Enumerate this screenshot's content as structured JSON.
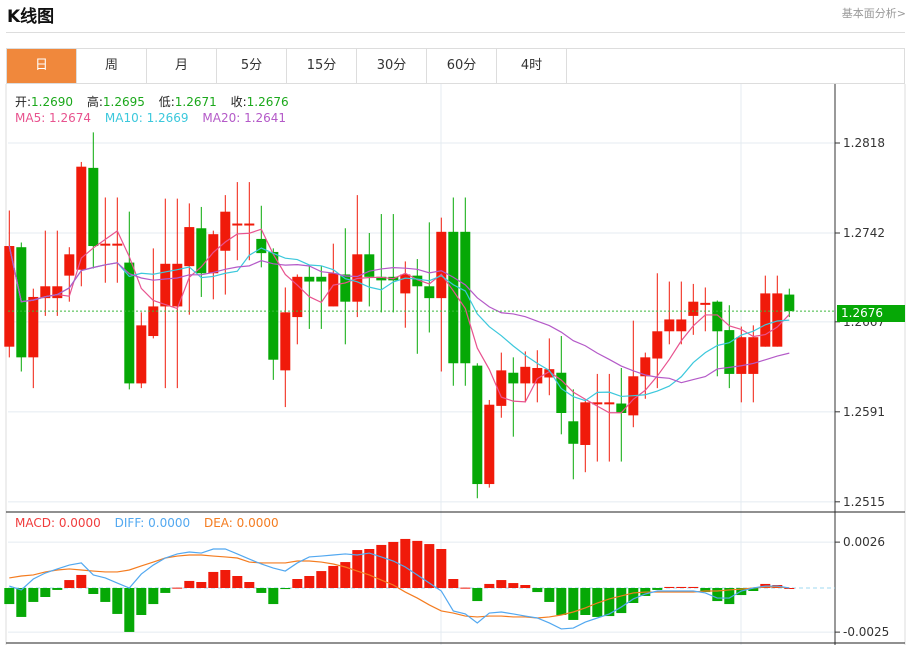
{
  "header": {
    "title": "K线图",
    "link": "基本面分析>"
  },
  "tabs": [
    {
      "label": "日",
      "active": true
    },
    {
      "label": "周"
    },
    {
      "label": "月"
    },
    {
      "label": "5分"
    },
    {
      "label": "15分"
    },
    {
      "label": "30分"
    },
    {
      "label": "60分"
    },
    {
      "label": "4时"
    }
  ],
  "ohlc_legend": {
    "open_label": "开:",
    "open": "1.2690",
    "high_label": "高:",
    "high": "1.2695",
    "low_label": "低:",
    "low": "1.2671",
    "close_label": "收:",
    "close": "1.2676"
  },
  "ma_legend": {
    "ma5": "MA5: 1.2674",
    "ma10": "MA10: 1.2669",
    "ma20": "MA20: 1.2641"
  },
  "macd_legend": {
    "macd": "MACD: 0.0000",
    "diff": "DIFF: 0.0000",
    "dea": "DEA: 0.0000"
  },
  "current_price": "1.2676",
  "colors": {
    "up": "#f01a0a",
    "down": "#06a806",
    "ma5": "#e8538f",
    "ma10": "#3cc8dc",
    "ma20": "#b45ac8",
    "diff": "#52a8f0",
    "dea": "#f47c20",
    "active_tab": "#f0883c"
  },
  "chart_data": [
    {
      "type": "candlestick",
      "ylim": [
        1.2505,
        1.283
      ],
      "yticks": [
        "1.2818",
        "1.2742",
        "1.2667",
        "1.2591",
        "1.2515"
      ],
      "grid": true,
      "ohlc": [
        [
          1.2646,
          1.2761,
          1.2637,
          1.2731
        ],
        [
          1.273,
          1.2734,
          1.2625,
          1.2637
        ],
        [
          1.2637,
          1.2695,
          1.2611,
          1.2688
        ],
        [
          1.2687,
          1.2744,
          1.2672,
          1.2697
        ],
        [
          1.2687,
          1.2744,
          1.2672,
          1.2697
        ],
        [
          1.2706,
          1.273,
          1.2684,
          1.2724
        ],
        [
          1.2711,
          1.2802,
          1.2697,
          1.2798
        ],
        [
          1.2797,
          1.2827,
          1.2712,
          1.2731
        ],
        [
          1.2733,
          1.2772,
          1.27,
          1.2733
        ],
        [
          1.2733,
          1.2772,
          1.27,
          1.2733
        ],
        [
          1.2717,
          1.276,
          1.261,
          1.2615
        ],
        [
          1.2615,
          1.2675,
          1.2611,
          1.2664
        ],
        [
          1.2655,
          1.2729,
          1.2653,
          1.268
        ],
        [
          1.268,
          1.2771,
          1.2611,
          1.2716
        ],
        [
          1.268,
          1.2771,
          1.2611,
          1.2716
        ],
        [
          1.2714,
          1.2767,
          1.2673,
          1.2747
        ],
        [
          1.2746,
          1.2764,
          1.2688,
          1.2708
        ],
        [
          1.2708,
          1.2744,
          1.2686,
          1.2741
        ],
        [
          1.2727,
          1.2774,
          1.269,
          1.276
        ],
        [
          1.275,
          1.2785,
          1.2719,
          1.275
        ],
        [
          1.275,
          1.2785,
          1.2719,
          1.275
        ],
        [
          1.2737,
          1.2765,
          1.2713,
          1.2725
        ],
        [
          1.2726,
          1.2729,
          1.2618,
          1.2635
        ],
        [
          1.2626,
          1.2696,
          1.2595,
          1.2675
        ],
        [
          1.2671,
          1.2707,
          1.2648,
          1.2705
        ],
        [
          1.2705,
          1.2714,
          1.2661,
          1.2701
        ],
        [
          1.2705,
          1.2714,
          1.2661,
          1.2701
        ],
        [
          1.268,
          1.2733,
          1.268,
          1.2708
        ],
        [
          1.2707,
          1.2746,
          1.2648,
          1.2684
        ],
        [
          1.2684,
          1.2774,
          1.2671,
          1.2724
        ],
        [
          1.2724,
          1.2742,
          1.268,
          1.2705
        ],
        [
          1.2705,
          1.2758,
          1.2675,
          1.2702
        ],
        [
          1.2705,
          1.2758,
          1.2675,
          1.2702
        ],
        [
          1.2691,
          1.2718,
          1.2662,
          1.2707
        ],
        [
          1.2706,
          1.272,
          1.264,
          1.2697
        ],
        [
          1.2697,
          1.2751,
          1.2658,
          1.2687
        ],
        [
          1.2687,
          1.2755,
          1.2625,
          1.2743
        ],
        [
          1.2743,
          1.2772,
          1.2613,
          1.2632
        ],
        [
          1.2743,
          1.2772,
          1.2613,
          1.2632
        ],
        [
          1.263,
          1.2632,
          1.2518,
          1.253
        ],
        [
          1.253,
          1.2601,
          1.2527,
          1.2597
        ],
        [
          1.2596,
          1.2641,
          1.2586,
          1.2626
        ],
        [
          1.2624,
          1.2637,
          1.257,
          1.2615
        ],
        [
          1.2615,
          1.2642,
          1.2599,
          1.2629
        ],
        [
          1.2615,
          1.2643,
          1.2599,
          1.2628
        ],
        [
          1.262,
          1.2653,
          1.2605,
          1.2627
        ],
        [
          1.2624,
          1.2655,
          1.2572,
          1.259
        ],
        [
          1.2583,
          1.261,
          1.2534,
          1.2564
        ],
        [
          1.2563,
          1.2601,
          1.254,
          1.2599
        ],
        [
          1.2599,
          1.2623,
          1.2549,
          1.2599
        ],
        [
          1.2599,
          1.2623,
          1.2549,
          1.2599
        ],
        [
          1.2598,
          1.2628,
          1.2549,
          1.259
        ],
        [
          1.2588,
          1.2668,
          1.2578,
          1.2621
        ],
        [
          1.2621,
          1.2641,
          1.2602,
          1.2637
        ],
        [
          1.2636,
          1.2708,
          1.2611,
          1.2659
        ],
        [
          1.2659,
          1.2701,
          1.2648,
          1.2669
        ],
        [
          1.2659,
          1.2701,
          1.2648,
          1.2669
        ],
        [
          1.2672,
          1.2699,
          1.2656,
          1.2684
        ],
        [
          1.2683,
          1.2696,
          1.2659,
          1.2683
        ],
        [
          1.2684,
          1.2685,
          1.2621,
          1.2659
        ],
        [
          1.266,
          1.2681,
          1.2611,
          1.2623
        ],
        [
          1.2623,
          1.2663,
          1.2599,
          1.2654
        ],
        [
          1.2623,
          1.2664,
          1.2599,
          1.2654
        ],
        [
          1.2646,
          1.2706,
          1.2646,
          1.2691
        ],
        [
          1.2646,
          1.2706,
          1.2646,
          1.2691
        ],
        [
          1.269,
          1.2695,
          1.2671,
          1.2676
        ]
      ]
    },
    {
      "type": "bar+line",
      "ylim": [
        -0.0028,
        0.0036
      ],
      "yticks": [
        "0.0026",
        "-0.0025"
      ],
      "macd": [
        -0.00091,
        -0.00164,
        -0.00079,
        -0.00051,
        -0.00011,
        0.00045,
        0.00074,
        -0.00034,
        -0.00079,
        -0.00147,
        -0.00249,
        -0.00153,
        -0.00091,
        -0.00028,
        2e-05,
        0.0004,
        0.00034,
        0.00091,
        0.00102,
        0.00068,
        0.00034,
        -0.00028,
        -0.00091,
        -6e-05,
        0.00051,
        0.00068,
        0.00096,
        0.00125,
        0.00147,
        0.00215,
        0.00221,
        0.00244,
        0.00261,
        0.00278,
        0.00267,
        0.00249,
        0.00221,
        0.00051,
        2e-05,
        -0.00074,
        0.00023,
        0.00045,
        0.00028,
        0.00017,
        -0.00023,
        -0.00079,
        -0.00153,
        -0.00181,
        -0.00153,
        -0.00164,
        -0.00159,
        -0.00142,
        -0.00085,
        -0.00045,
        -0.00011,
        6e-05,
        6e-05,
        6e-05,
        -0.00023,
        -0.00074,
        -0.00091,
        -0.0004,
        -0.00017,
        0.00023,
        0.00017,
        0
      ],
      "diff": [
        0.00011,
        -0.00011,
        0.00051,
        0.00085,
        0.00108,
        0.0013,
        0.00142,
        0.00074,
        0.00057,
        0.00028,
        0,
        0.00079,
        0.0013,
        0.0017,
        0.00193,
        0.00204,
        0.00198,
        0.00221,
        0.00221,
        0.00193,
        0.00164,
        0.00136,
        0.00113,
        0.00096,
        0.00142,
        0.00176,
        0.00181,
        0.00187,
        0.00193,
        0.00187,
        0.00198,
        0.00176,
        0.00153,
        0.00119,
        0.00074,
        0.00028,
        -0.00017,
        -0.0013,
        -0.00147,
        -0.00198,
        -0.00142,
        -0.00136,
        -0.00147,
        -0.00159,
        -0.0017,
        -0.00198,
        -0.00232,
        -0.00227,
        -0.00193,
        -0.0017,
        -0.00147,
        -0.00108,
        -0.00062,
        -0.00034,
        -0.00017,
        -0.00017,
        -0.00017,
        -0.00017,
        -0.00028,
        -0.00057,
        -0.00057,
        -0.00017,
        0,
        0.00011,
        0.00011,
        0
      ],
      "dea": [
        0.00057,
        0.00068,
        0.00074,
        0.00091,
        0.00102,
        0.00108,
        0.00102,
        0.00096,
        0.00091,
        0.00091,
        0.00102,
        0.00125,
        0.00147,
        0.0017,
        0.00181,
        0.00187,
        0.00187,
        0.00181,
        0.00176,
        0.0017,
        0.00147,
        0.00142,
        0.00142,
        0.00142,
        0.00153,
        0.00153,
        0.00147,
        0.00136,
        0.00119,
        0.00096,
        0.00074,
        0.00045,
        0.00017,
        -0.00023,
        -0.00057,
        -0.00096,
        -0.0013,
        -0.00142,
        -0.00159,
        -0.00164,
        -0.00159,
        -0.00159,
        -0.00164,
        -0.00164,
        -0.0017,
        -0.00164,
        -0.00153,
        -0.00136,
        -0.00113,
        -0.00085,
        -0.00062,
        -0.00045,
        -0.00028,
        -0.00023,
        -0.00023,
        -0.00023,
        -0.00023,
        -0.00023,
        -0.00017,
        -0.00017,
        -0.00011,
        -6e-05,
        0,
        6e-05,
        6e-05,
        0
      ]
    }
  ]
}
